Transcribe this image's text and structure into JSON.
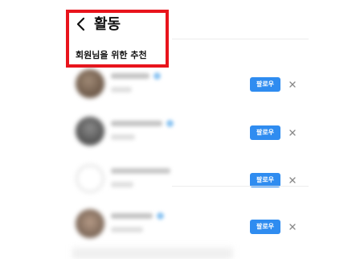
{
  "header": {
    "title": "활동",
    "back_icon": "chevron-left-icon"
  },
  "section": {
    "title": "회원님을 위한 추천"
  },
  "suggestions": [
    {
      "follow_label": "팔로우",
      "verified": true
    },
    {
      "follow_label": "팔로우",
      "verified": true
    },
    {
      "follow_label": "팔로우",
      "verified": false
    },
    {
      "follow_label": "팔로우",
      "verified": true
    }
  ],
  "colors": {
    "highlight_border": "#e8141c",
    "follow_button": "#2f8cf0",
    "follow_text": "#ffffff"
  },
  "icons": {
    "dismiss": "close-icon"
  }
}
